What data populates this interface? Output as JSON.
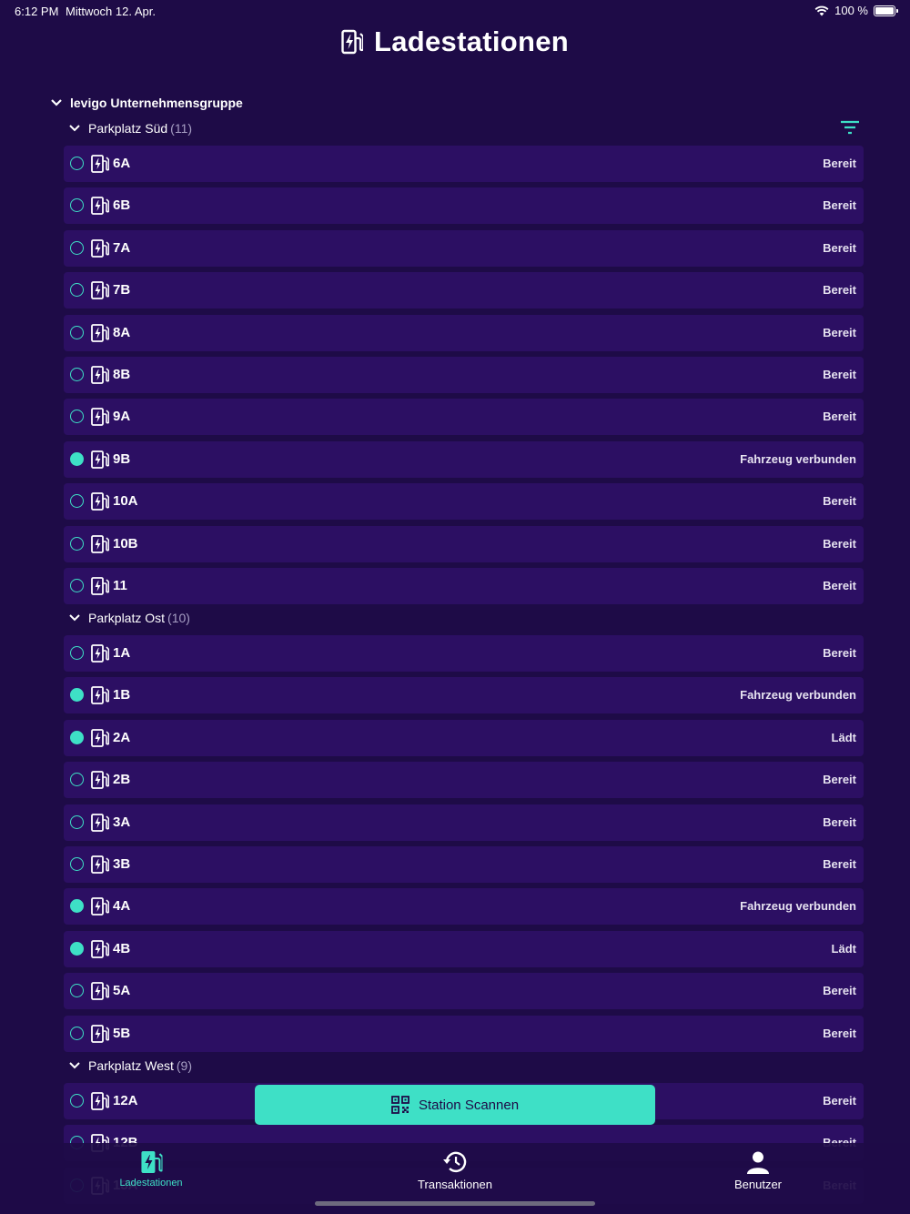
{
  "status_bar": {
    "time": "6:12 PM",
    "date": "Mittwoch 12. Apr.",
    "battery": "100 %"
  },
  "header": {
    "title": "Ladestationen"
  },
  "group": {
    "name": "levigo Unternehmensgruppe"
  },
  "sections": [
    {
      "name": "Parkplatz Süd",
      "count": "(11)",
      "stations": [
        {
          "name": "6A",
          "status": "Bereit",
          "active": false
        },
        {
          "name": "6B",
          "status": "Bereit",
          "active": false
        },
        {
          "name": "7A",
          "status": "Bereit",
          "active": false
        },
        {
          "name": "7B",
          "status": "Bereit",
          "active": false
        },
        {
          "name": "8A",
          "status": "Bereit",
          "active": false
        },
        {
          "name": "8B",
          "status": "Bereit",
          "active": false
        },
        {
          "name": "9A",
          "status": "Bereit",
          "active": false
        },
        {
          "name": "9B",
          "status": "Fahrzeug verbunden",
          "active": true
        },
        {
          "name": "10A",
          "status": "Bereit",
          "active": false
        },
        {
          "name": "10B",
          "status": "Bereit",
          "active": false
        },
        {
          "name": "11",
          "status": "Bereit",
          "active": false
        }
      ]
    },
    {
      "name": "Parkplatz Ost",
      "count": "(10)",
      "stations": [
        {
          "name": "1A",
          "status": "Bereit",
          "active": false
        },
        {
          "name": "1B",
          "status": "Fahrzeug verbunden",
          "active": true
        },
        {
          "name": "2A",
          "status": "Lädt",
          "active": true
        },
        {
          "name": "2B",
          "status": "Bereit",
          "active": false
        },
        {
          "name": "3A",
          "status": "Bereit",
          "active": false
        },
        {
          "name": "3B",
          "status": "Bereit",
          "active": false
        },
        {
          "name": "4A",
          "status": "Fahrzeug verbunden",
          "active": true
        },
        {
          "name": "4B",
          "status": "Lädt",
          "active": true
        },
        {
          "name": "5A",
          "status": "Bereit",
          "active": false
        },
        {
          "name": "5B",
          "status": "Bereit",
          "active": false
        }
      ]
    },
    {
      "name": "Parkplatz West",
      "count": "(9)",
      "stations": [
        {
          "name": "12A",
          "status": "Bereit",
          "active": false
        },
        {
          "name": "12B",
          "status": "Bereit",
          "active": false
        },
        {
          "name": "13A",
          "status": "Bereit",
          "active": false
        }
      ]
    }
  ],
  "scan_button": {
    "label": "Station Scannen"
  },
  "tabs": [
    {
      "label": "Ladestationen",
      "icon": "charging-station-icon",
      "active": true
    },
    {
      "label": "Transaktionen",
      "icon": "history-icon",
      "active": false
    },
    {
      "label": "Benutzer",
      "icon": "user-icon",
      "active": false
    }
  ],
  "colors": {
    "background": "#1e0b47",
    "row": "#2c0f63",
    "accent": "#3ee0c6"
  }
}
